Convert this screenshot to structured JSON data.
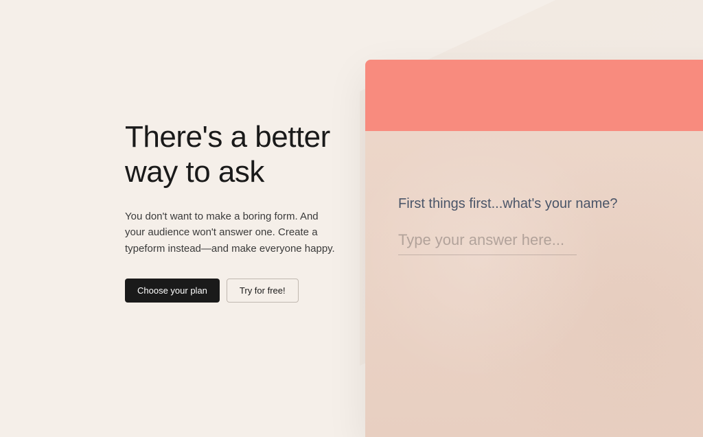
{
  "hero": {
    "headline": "There's a better way to ask",
    "description": "You don't want to make a boring form. And your audience won't answer one. Create a typeform instead—and make everyone happy.",
    "primary_cta": "Choose your plan",
    "secondary_cta": "Try for free!"
  },
  "form_preview": {
    "question": "First things first...what's your name?",
    "placeholder": "Type your answer here..."
  }
}
